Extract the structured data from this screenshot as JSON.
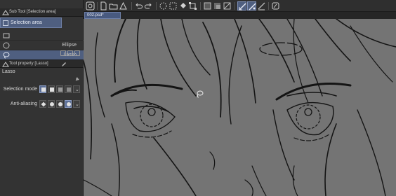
{
  "subtool": {
    "header_title": "Sub Tool [Selection area]",
    "tab_label": "Selection area",
    "items": [
      {
        "label": "",
        "icon": "rectangle-icon"
      },
      {
        "label": "Ellipse",
        "icon": "ellipse-icon"
      },
      {
        "label": "Lasso",
        "icon": "lasso-icon",
        "selected": true
      }
    ]
  },
  "tool_property": {
    "header_title": "Tool property [Lasso]",
    "tool_name": "Lasso",
    "selection_mode_label": "Selection mode",
    "anti_aliasing_label": "Anti-aliasing"
  },
  "document": {
    "tab_label": "002.psd*"
  },
  "colors": {
    "accent": "#4f5f80",
    "panel": "#333333",
    "canvas": "#747474"
  }
}
